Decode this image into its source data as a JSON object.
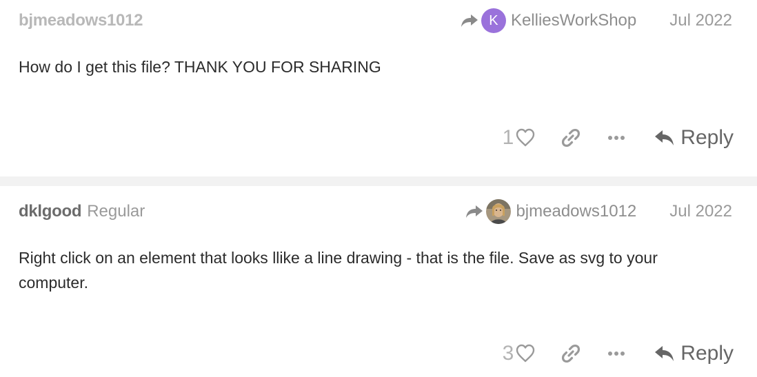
{
  "posts": [
    {
      "username": "bjmeadows1012",
      "title_badge": "",
      "reply_to": {
        "avatar_letter": "K",
        "avatar_color": "#9a72db",
        "username": "KelliesWorkShop"
      },
      "date": "Jul 2022",
      "body": "How do I get this file? THANK YOU FOR SHARING",
      "like_count": "1",
      "reply_label": "Reply"
    },
    {
      "username": "dklgood",
      "title_badge": "Regular",
      "reply_to": {
        "avatar_letter": "",
        "avatar_color": "",
        "username": "bjmeadows1012"
      },
      "date": "Jul 2022",
      "body": "Right click on an element that looks llike a line drawing - that is the file. Save as svg to your computer.",
      "like_count": "3",
      "reply_label": "Reply"
    }
  ],
  "icons": {
    "reply_arrow": "share-arrow-icon",
    "heart": "heart-icon",
    "link": "link-icon",
    "more": "ellipsis-icon",
    "reply": "reply-icon"
  },
  "colors": {
    "icon_gray": "#9a9a9a",
    "avatar_purple": "#9a72db",
    "divider": "#f2f2f2"
  }
}
